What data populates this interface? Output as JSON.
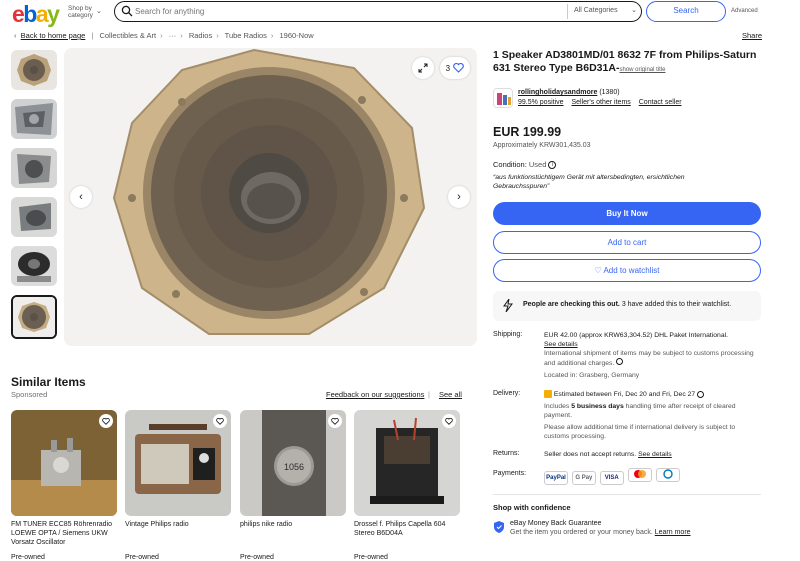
{
  "header": {
    "logo": [
      "e",
      "b",
      "a",
      "y"
    ],
    "shop_by": "Shop by category",
    "search_placeholder": "Search for anything",
    "category": "All Categories",
    "search_label": "Search",
    "advanced": "Advanced"
  },
  "breadcrumb": {
    "back": "Back to home page",
    "items": [
      "Collectibles & Art",
      "···",
      "Radios",
      "Tube Radios",
      "1960-Now"
    ],
    "share": "Share"
  },
  "gallery": {
    "watch_count": "3"
  },
  "listing": {
    "title": "1 Speaker AD3801MD/01 8632 7F from Philips-Saturn 631 Stereo Type B6D31A-",
    "show_original": "show original title",
    "seller_name": "rollingholidaysandmore",
    "seller_count": "(1380)",
    "seller_positive": "99.5% positive",
    "seller_other": "Seller's other items",
    "contact_seller": "Contact seller",
    "price": "EUR 199.99",
    "approx": "Approximately KRW301,435.03",
    "condition_label": "Condition:",
    "condition_value": "Used",
    "condition_note": "“aus funktionstüchtigem Gerät mit altersbedingten, ersichtlichen Gebrauchsspuren”",
    "buy_now": "Buy It Now",
    "add_to_cart": "Add to cart",
    "add_to_watchlist": "Add to watchlist",
    "alert_bold": "People are checking this out.",
    "alert_rest": "3 have added this to their watchlist."
  },
  "shipping": {
    "label": "Shipping:",
    "line1": "EUR 42.00 (approx KRW63,304.52) DHL Paket International.",
    "details": "See details",
    "note": "International shipment of items may be subject to customs processing and additional charges.",
    "location": "Located in: Grasberg, Germany"
  },
  "delivery": {
    "label": "Delivery:",
    "estimate": "Estimated between Fri, Dec 20 and Fri, Dec 27",
    "includes_pre": "Includes",
    "includes_bold": "5 business days",
    "includes_post": "handling time after receipt of cleared payment.",
    "allow": "Please allow additional time if international delivery is subject to customs processing."
  },
  "returns": {
    "label": "Returns:",
    "text": "Seller does not accept returns.",
    "details": "See details"
  },
  "payments": {
    "label": "Payments:",
    "methods": [
      "PayPal",
      "G Pay",
      "VISA",
      "MC",
      "DC"
    ]
  },
  "confidence": {
    "title": "Shop with confidence",
    "guarantee": "eBay Money Back Guarantee",
    "sub": "Get the item you ordered or your money back.",
    "learn_more": "Learn more"
  },
  "similar": {
    "title": "Similar Items",
    "sponsored": "Sponsored",
    "feedback": "Feedback on our suggestions",
    "see_all": "See all",
    "items": [
      {
        "title": "FM TUNER ECC85 Röhrenradio LOEWE OPTA / Siemens UKW Vorsatz Oscillator",
        "condition": "Pre-owned"
      },
      {
        "title": "Vintage Philips radio",
        "condition": "Pre-owned"
      },
      {
        "title": "philips nike radio",
        "condition": "Pre-owned"
      },
      {
        "title": "Drossel f. Philips Capella 604 Stereo B6D04A",
        "condition": "Pre-owned"
      }
    ],
    "dial_label": "1056"
  },
  "colors": {
    "accent": "#3665f3",
    "ebay_red": "#e53238",
    "ebay_blue": "#0064d2",
    "ebay_yellow": "#f5af02",
    "ebay_green": "#86b817"
  }
}
